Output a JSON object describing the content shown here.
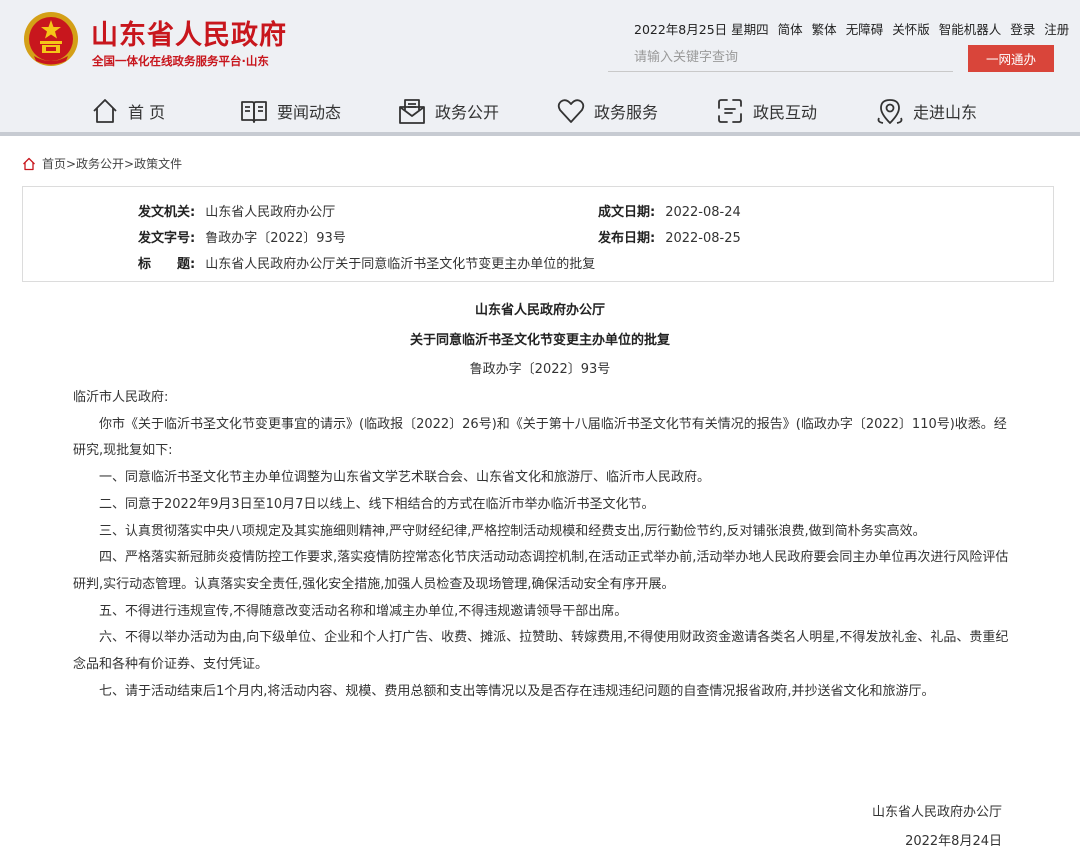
{
  "header": {
    "site_title": "山东省人民政府",
    "site_subtitle": "全国一体化在线政务服务平台·山东",
    "top_links": {
      "date": "2022年8月25日 星期四",
      "simplified": "简体",
      "traditional": "繁体",
      "accessibility": "无障碍",
      "elderly": "关怀版",
      "robot": "智能机器人",
      "login": "登录",
      "register": "注册"
    },
    "search": {
      "placeholder": "请输入关键字查询"
    },
    "yiwang_button": "一网通办",
    "brand_red": "#c8161d"
  },
  "nav": {
    "items": [
      {
        "label": "首 页",
        "icon": "home-icon"
      },
      {
        "label": "要闻动态",
        "icon": "book-icon"
      },
      {
        "label": "政务公开",
        "icon": "mail-icon"
      },
      {
        "label": "政务服务",
        "icon": "heart-icon"
      },
      {
        "label": "政民互动",
        "icon": "interaction-icon"
      },
      {
        "label": "走进山东",
        "icon": "location-icon"
      }
    ]
  },
  "breadcrumb": {
    "text": "首页>政务公开>政策文件"
  },
  "meta": {
    "issuer_label": "发文机关:",
    "issuer": "山东省人民政府办公厅",
    "doc_no_label": "发文字号:",
    "doc_no": "鲁政办字〔2022〕93号",
    "title_label": "标　　题:",
    "title": "山东省人民政府办公厅关于同意临沂书圣文化节变更主办单位的批复",
    "written_date_label": "成文日期:",
    "written_date": "2022-08-24",
    "publish_date_label": "发布日期:",
    "publish_date": "2022-08-25"
  },
  "document": {
    "issuer": "山东省人民政府办公厅",
    "title": "关于同意临沂书圣文化节变更主办单位的批复",
    "number": "鲁政办字〔2022〕93号",
    "salutation": "临沂市人民政府:",
    "paragraphs": [
      "你市《关于临沂书圣文化节变更事宜的请示》(临政报〔2022〕26号)和《关于第十八届临沂书圣文化节有关情况的报告》(临政办字〔2022〕110号)收悉。经研究,现批复如下:",
      "一、同意临沂书圣文化节主办单位调整为山东省文学艺术联合会、山东省文化和旅游厅、临沂市人民政府。",
      "二、同意于2022年9月3日至10月7日以线上、线下相结合的方式在临沂市举办临沂书圣文化节。",
      "三、认真贯彻落实中央八项规定及其实施细则精神,严守财经纪律,严格控制活动规模和经费支出,厉行勤俭节约,反对铺张浪费,做到简朴务实高效。",
      "四、严格落实新冠肺炎疫情防控工作要求,落实疫情防控常态化节庆活动动态调控机制,在活动正式举办前,活动举办地人民政府要会同主办单位再次进行风险评估研判,实行动态管理。认真落实安全责任,强化安全措施,加强人员检查及现场管理,确保活动安全有序开展。",
      "五、不得进行违规宣传,不得随意改变活动名称和增减主办单位,不得违规邀请领导干部出席。",
      "六、不得以举办活动为由,向下级单位、企业和个人打广告、收费、摊派、拉赞助、转嫁费用,不得使用财政资金邀请各类名人明星,不得发放礼金、礼品、贵重纪念品和各种有价证券、支付凭证。",
      "七、请于活动结束后1个月内,将活动内容、规模、费用总额和支出等情况以及是否存在违规违纪问题的自查情况报省政府,并抄送省文化和旅游厅。"
    ],
    "signature": "山东省人民政府办公厅",
    "date": "2022年8月24日"
  }
}
